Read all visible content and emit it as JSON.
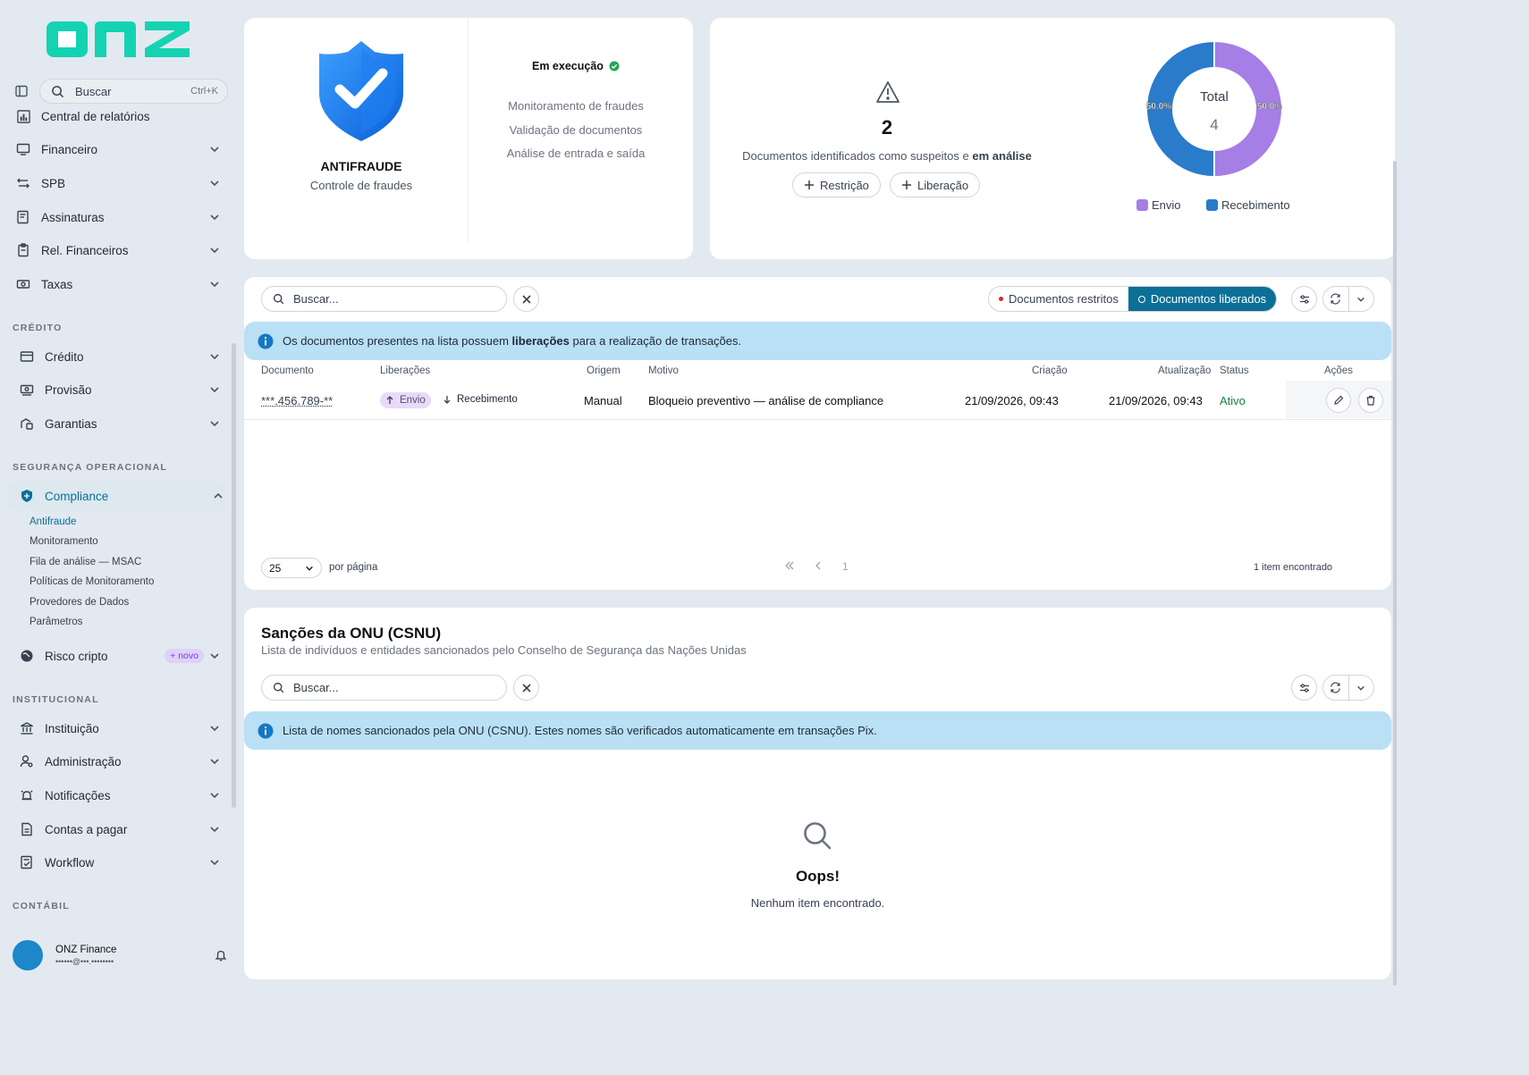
{
  "brand": {
    "logo_text": "onz"
  },
  "sidebar": {
    "search_placeholder": "Buscar",
    "search_shortcut": "Ctrl+K",
    "items_top": [
      {
        "label": "Central de relatórios",
        "icon": "report-icon"
      },
      {
        "label": "Financeiro",
        "icon": "finance-icon"
      },
      {
        "label": "SPB",
        "icon": "transfer-icon"
      },
      {
        "label": "Assinaturas",
        "icon": "signature-icon"
      },
      {
        "label": "Rel. Financeiros",
        "icon": "clipboard-icon"
      },
      {
        "label": "Taxas",
        "icon": "money-icon"
      }
    ],
    "section_credito": "CRÉDITO",
    "items_credito": [
      {
        "label": "Crédito",
        "icon": "card-icon"
      },
      {
        "label": "Provisão",
        "icon": "cash-icon"
      },
      {
        "label": "Garantias",
        "icon": "guarantee-icon"
      }
    ],
    "section_seguranca": "SEGURANÇA OPERACIONAL",
    "compliance_label": "Compliance",
    "compliance_sub": [
      "Antifraude",
      "Monitoramento",
      "Fila de análise — MSAC",
      "Políticas de Monitoramento",
      "Provedores de Dados",
      "Parâmetros"
    ],
    "risco_label": "Risco cripto",
    "risco_badge": "+ novo",
    "section_institucional": "INSTITUCIONAL",
    "items_institucional": [
      {
        "label": "Instituição",
        "icon": "bank-icon"
      },
      {
        "label": "Administração",
        "icon": "user-gear-icon"
      },
      {
        "label": "Notificações",
        "icon": "alarm-icon"
      },
      {
        "label": "Contas a pagar",
        "icon": "document-icon"
      },
      {
        "label": "Workflow",
        "icon": "workflow-icon"
      }
    ],
    "section_contabil": "CONTÁBIL",
    "user": {
      "name": "ONZ Finance",
      "email": "••••••@•••.••••••••"
    }
  },
  "antifraude": {
    "title": "ANTIFRAUDE",
    "subtitle": "Controle de fraudes",
    "status": "Em execução",
    "features": [
      "Monitoramento de fraudes",
      "Validação de documentos",
      "Análise de entrada e saída"
    ]
  },
  "suspeitos": {
    "count": "2",
    "desc_prefix": "Documentos identificados como suspeitos e",
    "desc_bold": "em análise",
    "btn_restricao": "Restrição",
    "btn_liberacao": "Liberação"
  },
  "donut": {
    "center_label": "Total",
    "center_value": "4",
    "slices": [
      {
        "name": "Envio",
        "percent": 50.0,
        "label": "50.0%",
        "color": "#a57ee6"
      },
      {
        "name": "Recebimento",
        "percent": 50.0,
        "label": "50.0%",
        "color": "#2a7bc9"
      }
    ]
  },
  "lista": {
    "search_placeholder": "Buscar...",
    "toggle_restritos": "Documentos restritos",
    "toggle_liberados": "Documentos liberados",
    "info_prefix": "Os documentos presentes na lista possuem",
    "info_bold": "liberações",
    "info_suffix": "para a realização de transações.",
    "columns": [
      "Documento",
      "Liberações",
      "Origem",
      "Motivo",
      "Criação",
      "Atualização",
      "Status",
      "Ações"
    ],
    "rows": [
      {
        "documento": "***.456.789-**",
        "envio": "Envio",
        "recebimento": "Recebimento",
        "origem": "Manual",
        "motivo": "Bloqueio preventivo — análise de compliance",
        "criacao": "21/09/2026, 09:43",
        "atualizacao": "21/09/2026, 09:43",
        "status": "Ativo"
      }
    ],
    "per_page": "25",
    "per_page_label": "por página",
    "page": "1",
    "found": "1 item encontrado"
  },
  "onu": {
    "title": "Sanções da ONU (CSNU)",
    "subtitle": "Lista de indivíduos e entidades sancionados pelo Conselho de Segurança das Nações Unidas",
    "search_placeholder": "Buscar...",
    "info": "Lista de nomes sancionados pela ONU (CSNU). Estes nomes são verificados automaticamente em transações Pix.",
    "empty_title": "Oops!",
    "empty_msg": "Nenhum item encontrado."
  },
  "colors": {
    "accent": "#0b6f97",
    "logo": "#14d3b2",
    "info_bg": "#b9e0f5",
    "status_active": "#15803d"
  }
}
